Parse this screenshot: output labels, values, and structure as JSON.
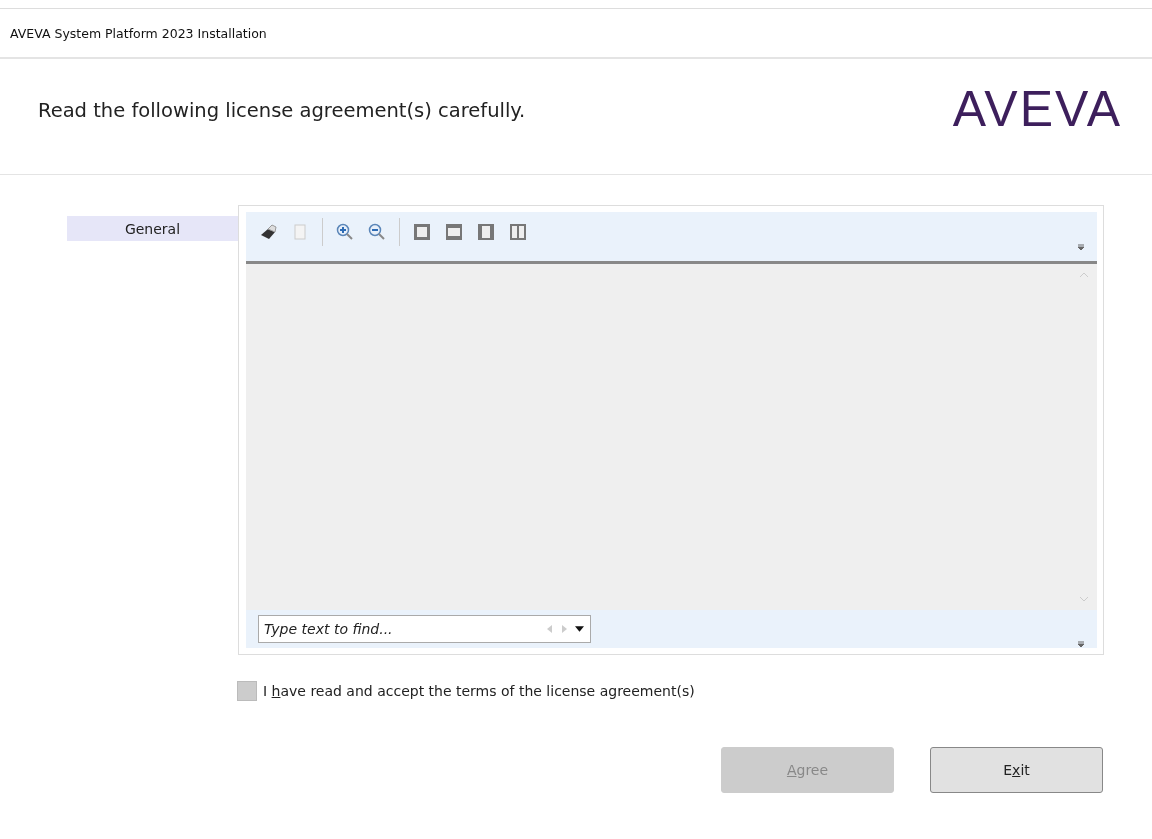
{
  "window": {
    "title": "AVEVA System Platform 2023 Installation"
  },
  "header": {
    "heading": "Read the following license agreement(s) carefully.",
    "logo": "AVEVA"
  },
  "sidebar": {
    "items": [
      {
        "label": "General",
        "selected": true
      }
    ]
  },
  "find": {
    "placeholder": "Type text to find..."
  },
  "accept": {
    "label": {
      "before": "I ",
      "access_key": "h",
      "after": "ave read and accept the terms of the license agreement(s)"
    },
    "checked": false
  },
  "buttons": [
    {
      "label": {
        "access_key": "A",
        "after": "gree"
      },
      "disabled": true
    },
    {
      "label": {
        "before": "E",
        "access_key": "x",
        "after": "it"
      },
      "disabled": false
    }
  ]
}
